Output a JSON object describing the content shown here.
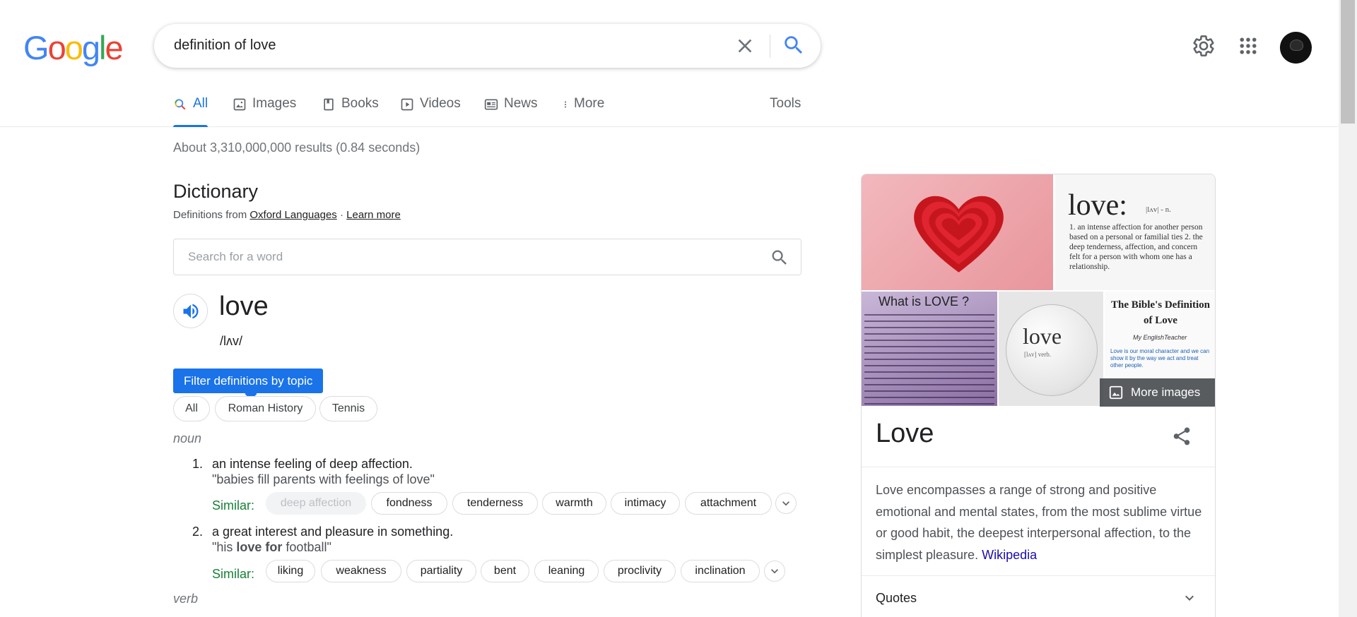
{
  "logo": {
    "letters": [
      "G",
      "o",
      "o",
      "g",
      "l",
      "e"
    ],
    "colors": [
      "#4285f4",
      "#ea4335",
      "#fbbc05",
      "#4285f4",
      "#34a853",
      "#ea4335"
    ]
  },
  "search": {
    "query": "definition of love"
  },
  "tabs": [
    {
      "label": "All",
      "icon": "search-icon"
    },
    {
      "label": "Images",
      "icon": "image-icon"
    },
    {
      "label": "Books",
      "icon": "book-icon"
    },
    {
      "label": "Videos",
      "icon": "video-icon"
    },
    {
      "label": "News",
      "icon": "news-icon"
    },
    {
      "label": "More",
      "icon": "more-vert-icon"
    }
  ],
  "tools_label": "Tools",
  "stats": "About 3,310,000,000 results (0.84 seconds)",
  "dictionary": {
    "title": "Dictionary",
    "source_prefix": "Definitions from",
    "source_link": "Oxford Languages",
    "separator": "·",
    "learn_more": "Learn more",
    "search_placeholder": "Search for a word",
    "word": "love",
    "phonetic": "/lʌv/",
    "filter_tip": "Filter definitions by topic",
    "topics": [
      "All",
      "Roman History",
      "Tennis"
    ],
    "noun_label": "noun",
    "verb_label": "verb",
    "definitions": [
      {
        "num": "1.",
        "text": "an intense feeling of deep affection.",
        "example": "\"babies fill parents with feelings of love\"",
        "similar_label": "Similar:",
        "similar": [
          "deep affection",
          "fondness",
          "tenderness",
          "warmth",
          "intimacy",
          "attachment"
        ]
      },
      {
        "num": "2.",
        "text": "a great interest and pleasure in something.",
        "example_pre": "\"his ",
        "example_bold": "love for",
        "example_post": " football\"",
        "similar_label": "Similar:",
        "similar": [
          "liking",
          "weakness",
          "partiality",
          "bent",
          "leaning",
          "proclivity",
          "inclination"
        ]
      }
    ]
  },
  "panel": {
    "img2_word": "love:",
    "img2_phon": "|lʌv| - n.",
    "img2_text": "1. an intense affection for another person based on a personal or familial ties 2. the deep tenderness, affection, and concern felt for a person with whom one has a relationship.",
    "img3_title": "What is LOVE ?",
    "img4_word": "love",
    "img4_sub": "[lʌv] verb.",
    "img5_title": "The Bible's Definition of Love",
    "img5_brand": "My EnglishTeacher",
    "img5_text": "Love is our moral character and we can show it by the way we act and treat other people.",
    "more_images": "More images",
    "title": "Love",
    "description": "Love encompasses a range of strong and positive emotional and mental states, from the most sublime virtue or good habit, the deepest interpersonal affection, to the simplest pleasure.",
    "desc_link": "Wikipedia",
    "quotes": "Quotes"
  },
  "colors": {
    "accent": "#1a73e8",
    "similar": "#188038",
    "link": "#1a0dab"
  }
}
